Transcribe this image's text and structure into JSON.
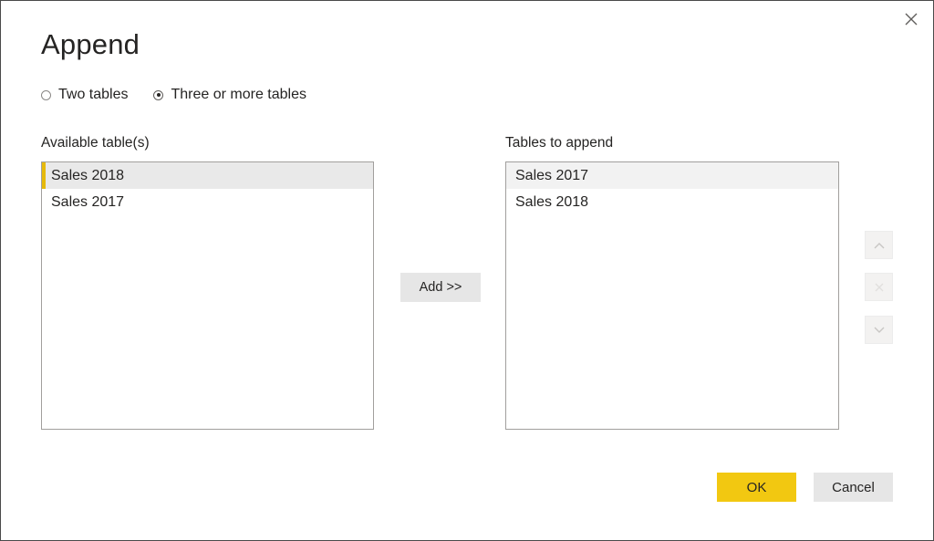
{
  "dialog": {
    "title": "Append",
    "close_icon": "close-icon"
  },
  "mode": {
    "options": [
      {
        "label": "Two tables",
        "checked": false
      },
      {
        "label": "Three or more tables",
        "checked": true
      }
    ]
  },
  "available": {
    "label": "Available table(s)",
    "items": [
      "Sales 2018",
      "Sales 2017"
    ],
    "selected_index": 0
  },
  "to_append": {
    "label": "Tables to append",
    "items": [
      "Sales 2017",
      "Sales 2018"
    ],
    "highlighted_index": 0
  },
  "add_button": {
    "label": "Add >>"
  },
  "side_buttons": {
    "up_icon": "chevron-up-icon",
    "remove_icon": "remove-x-icon",
    "down_icon": "chevron-down-icon"
  },
  "footer": {
    "ok_label": "OK",
    "cancel_label": "Cancel"
  },
  "colors": {
    "accent": "#f2c811",
    "selection_bar": "#e6b90b",
    "selected_bg": "#e9e9e9",
    "button_bg": "#e6e6e6"
  }
}
